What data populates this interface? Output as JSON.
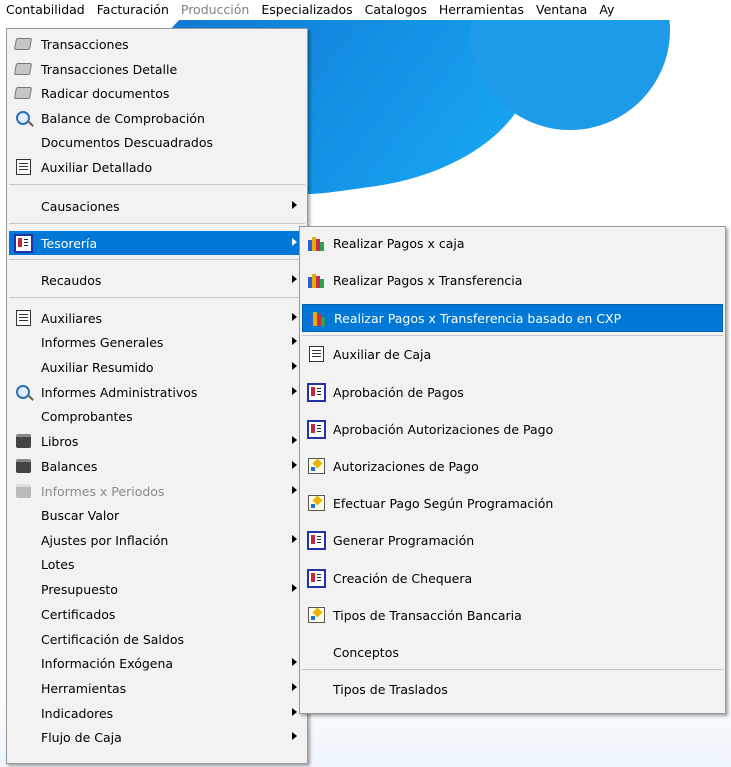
{
  "menubar": {
    "items": [
      {
        "label": "Contabilidad",
        "disabled": false
      },
      {
        "label": "Facturación",
        "disabled": false
      },
      {
        "label": "Producción",
        "disabled": true
      },
      {
        "label": "Especializados",
        "disabled": false
      },
      {
        "label": "Catalogos",
        "disabled": false
      },
      {
        "label": "Herramientas",
        "disabled": false
      },
      {
        "label": "Ventana",
        "disabled": false
      },
      {
        "label": "Ay",
        "disabled": false
      }
    ]
  },
  "main_menu": {
    "items": [
      {
        "label": "Transacciones",
        "icon": "document-icon"
      },
      {
        "label": "Transacciones Detalle",
        "icon": "document-icon"
      },
      {
        "label": "Radicar documentos",
        "icon": "document-icon"
      },
      {
        "label": "Balance de Comprobación",
        "icon": "magnifier-icon"
      },
      {
        "label": "Documentos Descuadrados",
        "icon": ""
      },
      {
        "label": "Auxiliar Detallado",
        "icon": "ledger-icon"
      },
      {
        "label": "Causaciones",
        "icon": "",
        "submenu": true
      },
      {
        "label": "Tesorería",
        "icon": "chart-report-icon",
        "submenu": true,
        "selected": true
      },
      {
        "label": "Recaudos",
        "icon": "",
        "submenu": true
      },
      {
        "label": "Auxiliares",
        "icon": "ledger-icon",
        "submenu": true
      },
      {
        "label": "Informes Generales",
        "icon": "",
        "submenu": true
      },
      {
        "label": "Auxiliar Resumido",
        "icon": "",
        "submenu": true
      },
      {
        "label": "Informes Administrativos",
        "icon": "magnifier-icon",
        "submenu": true
      },
      {
        "label": "Comprobantes",
        "icon": ""
      },
      {
        "label": "Libros",
        "icon": "printer-icon",
        "submenu": true
      },
      {
        "label": "Balances",
        "icon": "printer-icon",
        "submenu": true
      },
      {
        "label": "Informes x Periodos",
        "icon": "printer-icon",
        "submenu": true,
        "disabled": true
      },
      {
        "label": "Buscar Valor",
        "icon": ""
      },
      {
        "label": "Ajustes por Inflación",
        "icon": "",
        "submenu": true
      },
      {
        "label": "Lotes",
        "icon": ""
      },
      {
        "label": "Presupuesto",
        "icon": "",
        "submenu": true
      },
      {
        "label": "Certificados",
        "icon": ""
      },
      {
        "label": "Certificación de Saldos",
        "icon": ""
      },
      {
        "label": "Información Exógena",
        "icon": "",
        "submenu": true
      },
      {
        "label": "Herramientas",
        "icon": "",
        "submenu": true
      },
      {
        "label": "Indicadores",
        "icon": "",
        "submenu": true
      },
      {
        "label": "Flujo de Caja",
        "icon": "",
        "submenu": true
      }
    ]
  },
  "tesoreria_submenu": {
    "items": [
      {
        "label": "Realizar Pagos x caja",
        "icon": "books-icon"
      },
      {
        "label": "Realizar Pagos x Transferencia",
        "icon": "books-icon"
      },
      {
        "label": "Realizar Pagos x Transferencia basado en CXP",
        "icon": "books-icon",
        "selected": true
      },
      {
        "label": "Auxiliar de Caja",
        "icon": "ledger-icon"
      },
      {
        "label": "Aprobación de Pagos",
        "icon": "chart-report-icon"
      },
      {
        "label": "Aprobación Autorizaciones de Pago",
        "icon": "chart-report-icon"
      },
      {
        "label": "Autorizaciones de Pago",
        "icon": "check-form-icon"
      },
      {
        "label": "Efectuar Pago Según Programación",
        "icon": "check-form-icon"
      },
      {
        "label": "Generar Programación",
        "icon": "chart-report-icon"
      },
      {
        "label": "Creación de Chequera",
        "icon": "chart-report-icon"
      },
      {
        "label": "Tipos de Transacción Bancaria",
        "icon": "check-form-icon"
      },
      {
        "label": "Conceptos",
        "icon": ""
      },
      {
        "label": "Tipos de Traslados",
        "icon": ""
      }
    ]
  },
  "colors": {
    "selection": "#0078d7",
    "menu_bg": "#f2f2f2",
    "disabled_text": "#8c8c8c"
  }
}
